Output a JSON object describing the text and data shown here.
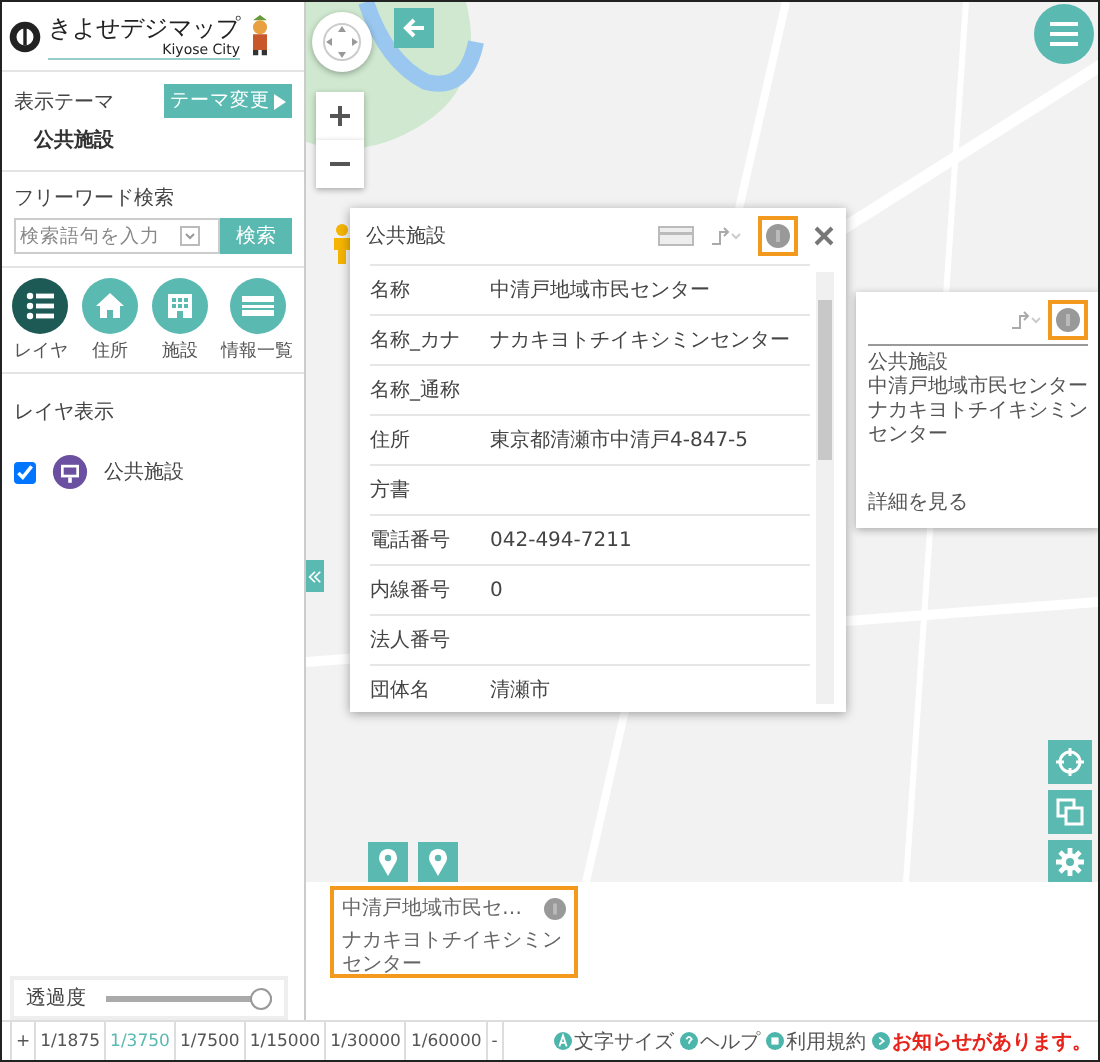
{
  "header": {
    "title": "きよせデジマップ",
    "subtitle": "Kiyose City"
  },
  "theme": {
    "label": "表示テーマ",
    "button": "テーマ変更",
    "value": "公共施設"
  },
  "search": {
    "label": "フリーワード検索",
    "placeholder": "検索語句を入力",
    "button": "検索"
  },
  "tools": [
    {
      "label": "レイヤ",
      "kind": "list",
      "selected": true
    },
    {
      "label": "住所",
      "kind": "house",
      "selected": false
    },
    {
      "label": "施設",
      "kind": "building",
      "selected": false
    },
    {
      "label": "情報一覧",
      "kind": "card",
      "selected": false
    }
  ],
  "layers": {
    "title": "レイヤ表示",
    "items": [
      {
        "label": "公共施設",
        "checked": true
      }
    ]
  },
  "opacity": {
    "label": "透過度",
    "level": 1
  },
  "popup": {
    "title": "公共施設",
    "rows": [
      {
        "label": "名称",
        "value": "中清戸地域市民センター"
      },
      {
        "label": "名称_カナ",
        "value": "ナカキヨトチイキシミンセンター"
      },
      {
        "label": "名称_通称",
        "value": ""
      },
      {
        "label": "住所",
        "value": "東京都清瀬市中清戸4-847-5"
      },
      {
        "label": "方書",
        "value": ""
      },
      {
        "label": "電話番号",
        "value": "042-494-7211"
      },
      {
        "label": "内線番号",
        "value": "0"
      },
      {
        "label": "法人番号",
        "value": ""
      },
      {
        "label": "団体名",
        "value": "清瀬市"
      }
    ]
  },
  "info_window": {
    "lines": [
      "公共施設",
      "中清戸地域市民センター",
      "ナカキヨトチイキシミンセンター"
    ],
    "link": "詳細を見る"
  },
  "selection_card": {
    "title": "中清戸地域市民セ…",
    "subtitle": "ナカキヨトチイキシミンセンター"
  },
  "scale_bar": {
    "zoom_in": "+",
    "zoom_out": "-",
    "scales": [
      {
        "label": "1/1875",
        "selected": false
      },
      {
        "label": "1/3750",
        "selected": true
      },
      {
        "label": "1/7500",
        "selected": false
      },
      {
        "label": "1/15000",
        "selected": false
      },
      {
        "label": "1/30000",
        "selected": false
      },
      {
        "label": "1/60000",
        "selected": false
      }
    ]
  },
  "footer_links": [
    {
      "label": "文字サイズ",
      "kind": "font"
    },
    {
      "label": "ヘルプ",
      "kind": "help"
    },
    {
      "label": "利用規約",
      "kind": "terms"
    },
    {
      "label": "お知らせがあります。",
      "kind": "notice"
    }
  ]
}
